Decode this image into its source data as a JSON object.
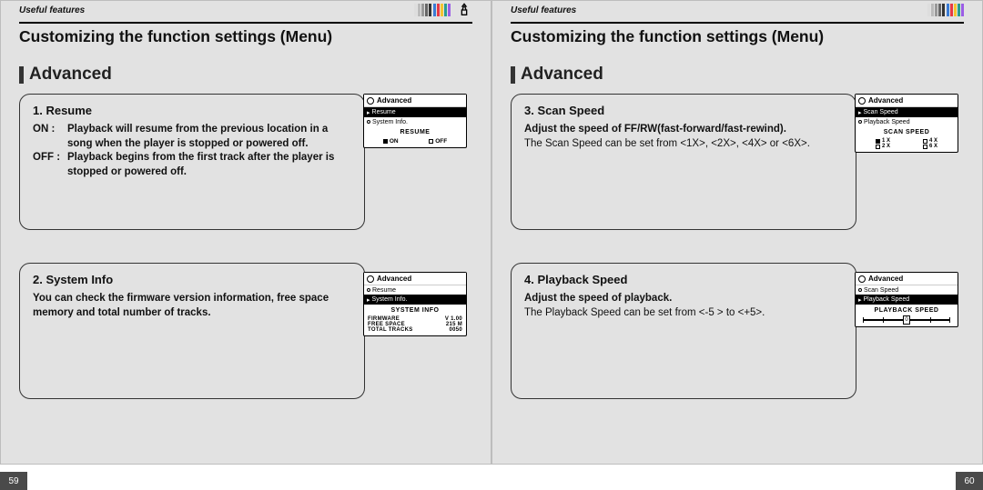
{
  "header": {
    "label": "Useful features"
  },
  "title": "Customizing the function settings (Menu)",
  "section": "Advanced",
  "pages": {
    "left": "59",
    "right": "60"
  },
  "left": {
    "box1": {
      "label": "1. Resume",
      "on_label": "ON :",
      "on_text": "Playback will resume from the previous location in a song when the player is stopped or powered off.",
      "off_label": "OFF :",
      "off_text": "Playback begins from the first track after the player is stopped or powered off."
    },
    "box2": {
      "label": "2. System Info",
      "text": "You can check the firmware version information, free space memory and total number of tracks."
    },
    "screen1": {
      "title": "Advanced",
      "item1": "Resume",
      "item2": "System Info.",
      "heading": "RESUME",
      "opt_on": "ON",
      "opt_off": "OFF"
    },
    "screen2": {
      "title": "Advanced",
      "item1": "Resume",
      "item2": "System Info.",
      "heading": "SYSTEM INFO",
      "k1": "FIRMWARE",
      "v1": "V 1.00",
      "k2": "FREE SPACE",
      "v2": "215 M",
      "k3": "TOTAL TRACKS",
      "v3": "0050"
    }
  },
  "right": {
    "box1": {
      "label": "3. Scan Speed",
      "bold": "Adjust the speed of FF/RW(fast-forward/fast-rewind).",
      "text": "The Scan Speed can be set from <1X>, <2X>, <4X> or <6X>."
    },
    "box2": {
      "label": "4. Playback Speed",
      "bold": "Adjust the speed of playback.",
      "text": "The Playback Speed can be set from <-5 > to <+5>."
    },
    "screen1": {
      "title": "Advanced",
      "item1": "Scan Speed",
      "item2": "Playback Speed",
      "heading": "SCAN SPEED",
      "o1": "1 X",
      "o2": "4 X",
      "o3": "2 X",
      "o4": "6 X"
    },
    "screen2": {
      "title": "Advanced",
      "item1": "Scan Speed",
      "item2": "Playback Speed",
      "heading": "PLAYBACK SPEED"
    }
  }
}
